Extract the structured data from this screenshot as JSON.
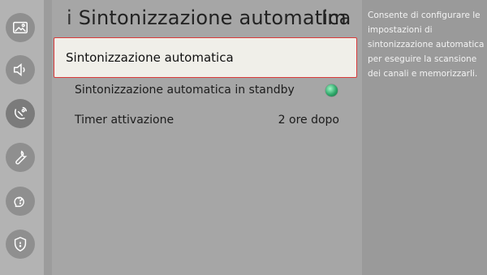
{
  "sidebar": {
    "items": [
      {
        "icon": "picture-icon"
      },
      {
        "icon": "sound-icon"
      },
      {
        "icon": "broadcast-icon",
        "active": true
      },
      {
        "icon": "wrench-icon"
      },
      {
        "icon": "support-icon"
      },
      {
        "icon": "shield-icon"
      }
    ]
  },
  "header": {
    "title_prefix": "i",
    "title": "Sintonizzazione automatica",
    "title_suffix": "Im"
  },
  "menu": {
    "items": [
      {
        "label": "Sintonizzazione automatica",
        "selected": true
      },
      {
        "label": "Sintonizzazione automatica in standby",
        "status": "on"
      },
      {
        "label": "Timer attivazione",
        "value": "2 ore dopo"
      }
    ]
  },
  "help": {
    "text": "Consente di configurare le impostazioni di sintonizzazione automatica per eseguire la scansione dei canali e memorizzarli."
  },
  "colors": {
    "selection_border": "#d93a3a",
    "status_on": "#2ea86a"
  }
}
